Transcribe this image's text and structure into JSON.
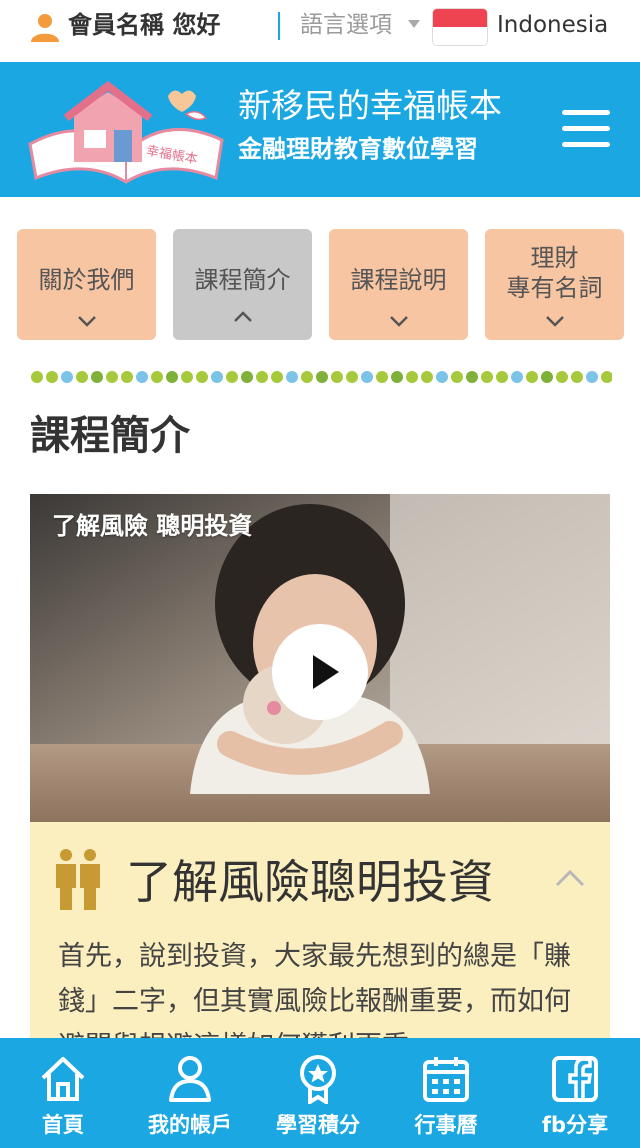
{
  "topbar": {
    "member_greeting": "會員名稱 您好",
    "language_label": "語言選項",
    "language_value": "Indonesia",
    "flag": "indonesia-flag"
  },
  "header": {
    "logo_caption": "幸福帳本",
    "title_line1": "新移民的幸福帳本",
    "title_line2": "金融理財教育數位學習",
    "menu_icon": "hamburger-icon"
  },
  "nav": {
    "items": [
      {
        "label": "關於我們",
        "chevron": "down"
      },
      {
        "label": "課程簡介",
        "chevron": "up",
        "active": true
      },
      {
        "label": "課程說明",
        "chevron": "down"
      },
      {
        "label": "理財\n專有名詞",
        "chevron": "down"
      }
    ]
  },
  "section": {
    "title": "課程簡介"
  },
  "video": {
    "overlay_title": "了解風險 聰明投資",
    "play_icon": "play-icon"
  },
  "info": {
    "title": "了解風險聰明投資",
    "body": "首先，說到投資，大家最先想到的總是「賺錢」二字，但其實風險比報酬重要，而如何避開與規避這樣如何獲利更重"
  },
  "bottom_nav": {
    "items": [
      {
        "label": "首頁",
        "icon": "home-icon"
      },
      {
        "label": "我的帳戶",
        "icon": "user-icon"
      },
      {
        "label": "學習積分",
        "icon": "medal-icon"
      },
      {
        "label": "行事曆",
        "icon": "calendar-icon"
      },
      {
        "label": "fb分享",
        "icon": "facebook-icon"
      }
    ]
  },
  "colors": {
    "brand_blue": "#1ba7e1",
    "nav_peach": "#f7c5a2",
    "nav_active": "#c8c8c8",
    "info_bg": "#fbeebf",
    "dot_green": "#a6c93b",
    "dot_blue": "#7cc3e8"
  }
}
